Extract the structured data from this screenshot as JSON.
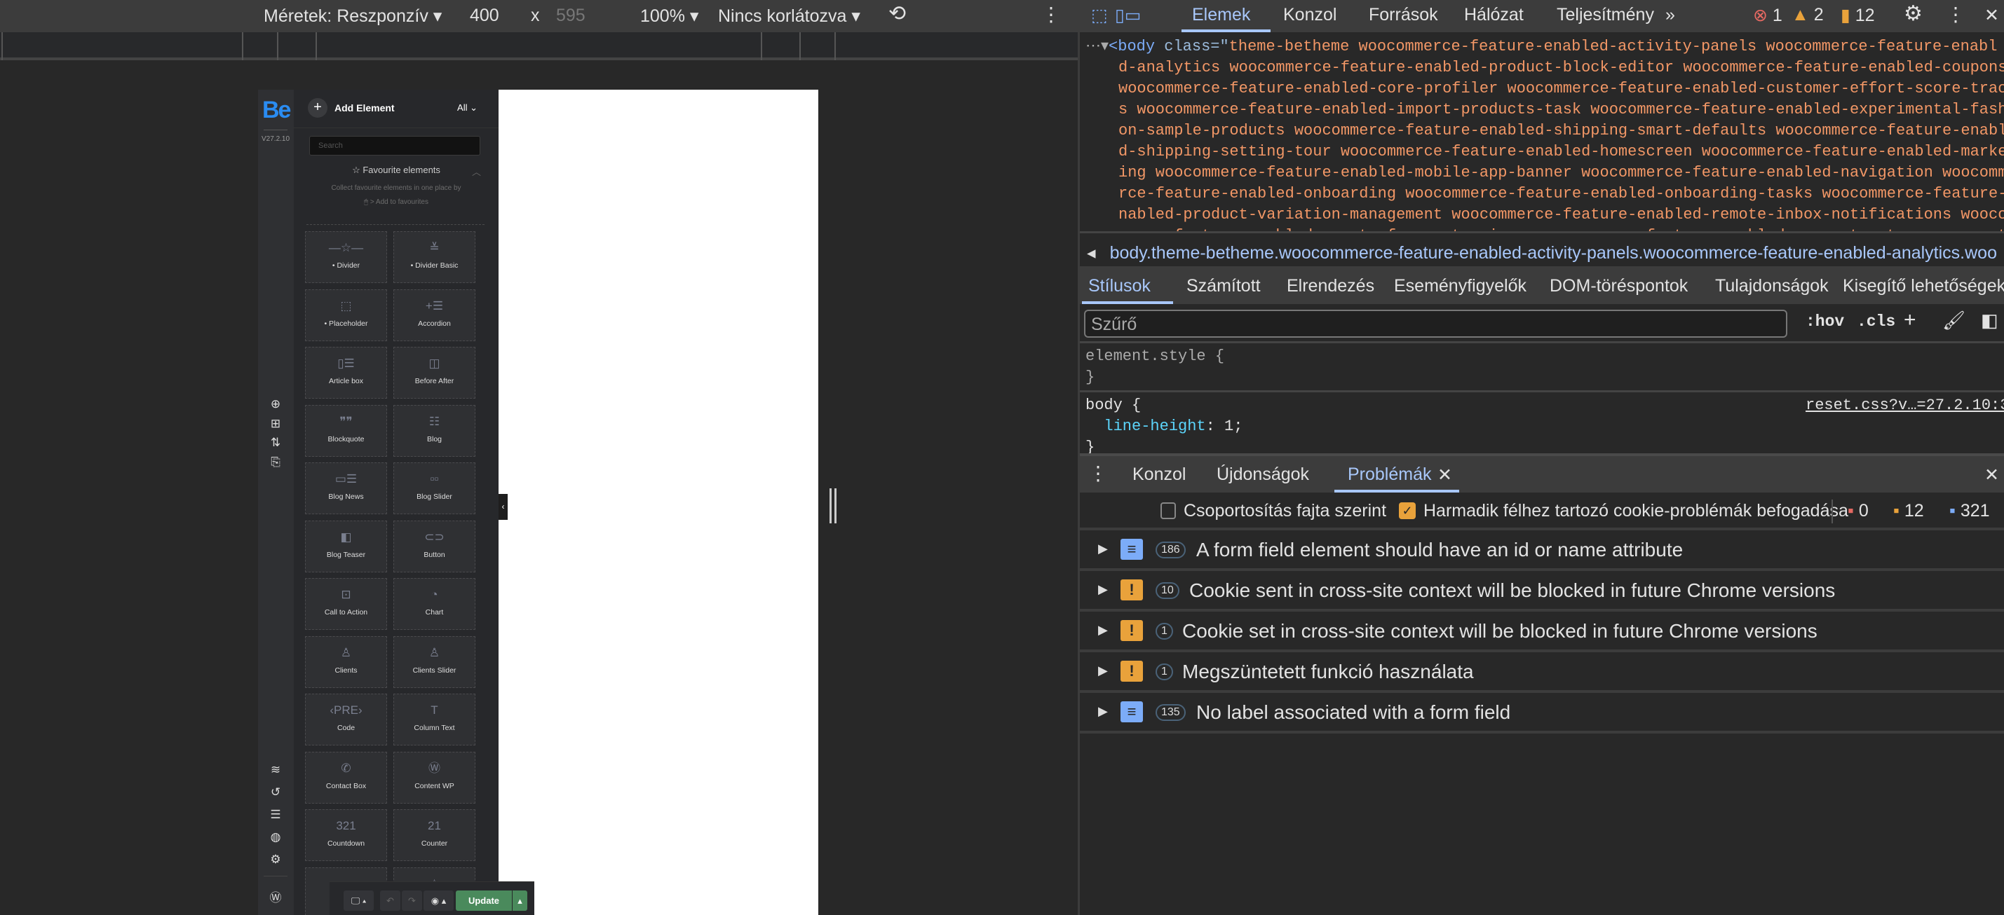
{
  "emulation": {
    "dimensions_label": "Méretek: Reszponzív",
    "width": "400",
    "times": "x",
    "height": "595",
    "zoom": "100%",
    "throttle": "Nincs korlátozva"
  },
  "builder": {
    "logo": "Be",
    "version": "V27.2.10",
    "add_element": "Add Element",
    "filter": "All",
    "search_placeholder": "Search",
    "favourites_title": "Favourite elements",
    "favourites_hint": "Collect favourite elements in one place by",
    "favourites_hint2": "> Add to favourites",
    "elements": [
      {
        "label": "• Divider",
        "icon": "—☆—"
      },
      {
        "label": "• Divider Basic",
        "icon": "≚"
      },
      {
        "label": "• Placeholder",
        "icon": "⬚"
      },
      {
        "label": "Accordion",
        "icon": "+☰"
      },
      {
        "label": "Article box",
        "icon": "▯☰"
      },
      {
        "label": "Before After",
        "icon": "◫"
      },
      {
        "label": "Blockquote",
        "icon": "❞❞"
      },
      {
        "label": "Blog",
        "icon": "☷"
      },
      {
        "label": "Blog News",
        "icon": "▭☰"
      },
      {
        "label": "Blog Slider",
        "icon": "▫▫"
      },
      {
        "label": "Blog Teaser",
        "icon": "◧"
      },
      {
        "label": "Button",
        "icon": "⊂⊃"
      },
      {
        "label": "Call to Action",
        "icon": "⊡"
      },
      {
        "label": "Chart",
        "icon": "◔"
      },
      {
        "label": "Clients",
        "icon": "♙"
      },
      {
        "label": "Clients Slider",
        "icon": "♙"
      },
      {
        "label": "Code",
        "icon": "‹PRE›"
      },
      {
        "label": "Column Text",
        "icon": "T"
      },
      {
        "label": "Contact Box",
        "icon": "✆"
      },
      {
        "label": "Content WP",
        "icon": "Ⓦ"
      },
      {
        "label": "Countdown",
        "icon": "321"
      },
      {
        "label": "Counter",
        "icon": "21"
      },
      {
        "label": "",
        "icon": "·"
      },
      {
        "label": "",
        "icon": "☆"
      }
    ],
    "update": "Update"
  },
  "devtools": {
    "tabs": [
      "Elemek",
      "Konzol",
      "Források",
      "Hálózat",
      "Teljesítmény"
    ],
    "more": "»",
    "errors": "1",
    "warnings": "2",
    "issues": "12",
    "code": {
      "tag_open": "<body",
      "attr_name": " class",
      "eq": "=\"",
      "lines": [
        "theme-betheme woocommerce-feature-enabled-activity-panels woocommerce-feature-enabl",
        "d-analytics woocommerce-feature-enabled-product-block-editor woocommerce-feature-enabled-coupons",
        "woocommerce-feature-enabled-core-profiler woocommerce-feature-enabled-customer-effort-score-trac",
        "s woocommerce-feature-enabled-import-products-task woocommerce-feature-enabled-experimental-fash",
        "on-sample-products woocommerce-feature-enabled-shipping-smart-defaults woocommerce-feature-enabl",
        "d-shipping-setting-tour woocommerce-feature-enabled-homescreen woocommerce-feature-enabled-marke",
        "ing woocommerce-feature-enabled-mobile-app-banner woocommerce-feature-enabled-navigation woocomm",
        "rce-feature-enabled-onboarding woocommerce-feature-enabled-onboarding-tasks woocommerce-feature-",
        "nabled-product-variation-management woocommerce-feature-enabled-remote-inbox-notifications wooco",
        "merce-feature-enabled-remote-free-extensions woocommerce-feature-enabled-payment-gateway-suggest"
      ]
    },
    "breadcrumb": "body.theme-betheme.woocommerce-feature-enabled-activity-panels.woocommerce-feature-enabled-analytics.woo",
    "style_tabs": [
      "Stílusok",
      "Számított",
      "Elrendezés",
      "Eseményfigyelők",
      "DOM-töréspontok",
      "Tulajdonságok",
      "Kisegítő lehetőségek"
    ],
    "filter_placeholder": "Szűrő",
    "hov": ":hov",
    "cls": ".cls",
    "rules": {
      "element_style": "element.style {",
      "close": "}",
      "body_selector": "body {",
      "prop": "line-height",
      "value": ": 1;",
      "source": "reset.css?v…=27.2.10:3"
    },
    "drawer_tabs": [
      "Konzol",
      "Újdonságok",
      "Problémák"
    ],
    "toolbar": {
      "group_label": "Csoportosítás fajta szerint",
      "group_checked": false,
      "third_party_label": "Harmadik félhez tartozó cookie-problémák befogadása",
      "third_party_checked": true,
      "errors": "0",
      "warnings": "12",
      "infos": "321"
    },
    "issues_list": [
      {
        "kind": "info",
        "count": "186",
        "text": "A form field element should have an id or name attribute"
      },
      {
        "kind": "warning",
        "count": "10",
        "text": "Cookie sent in cross-site context will be blocked in future Chrome versions"
      },
      {
        "kind": "warning",
        "count": "1",
        "text": "Cookie set in cross-site context will be blocked in future Chrome versions"
      },
      {
        "kind": "warning",
        "count": "1",
        "text": "Megszüntetett funkció használata"
      },
      {
        "kind": "info",
        "count": "135",
        "text": "No label associated with a form field"
      }
    ],
    "colors": {
      "info": "#7cacf8",
      "warning": "#e9a23b",
      "error": "#e46962",
      "accent": "#a8c7fa"
    }
  }
}
